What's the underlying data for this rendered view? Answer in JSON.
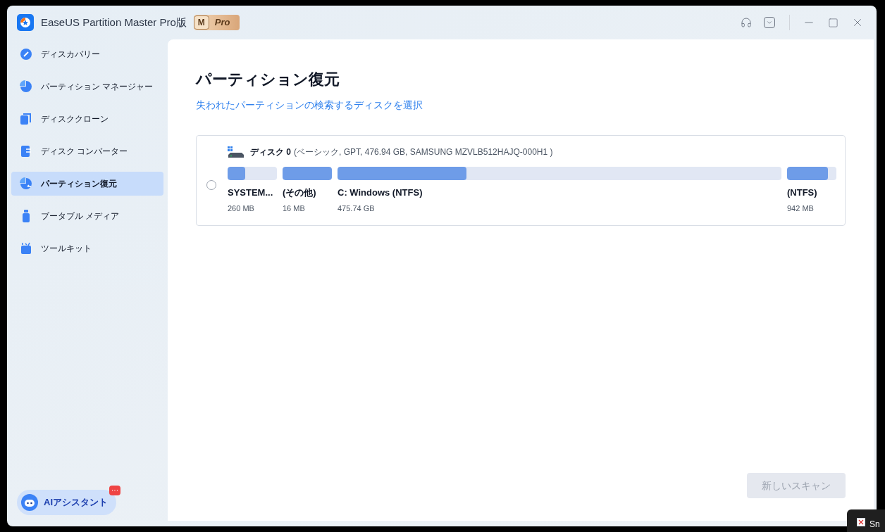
{
  "window": {
    "title": "EaseUS Partition Master Pro版",
    "badge": {
      "letter": "M",
      "label": "Pro"
    }
  },
  "sidebar": {
    "items": [
      {
        "label": "ディスカバリー",
        "selected": false
      },
      {
        "label": "パーティション マネージャー",
        "selected": false
      },
      {
        "label": "ディスククローン",
        "selected": false
      },
      {
        "label": "ディスク コンバーター",
        "selected": false
      },
      {
        "label": "パーティション復元",
        "selected": true
      },
      {
        "label": "ブータブル メディア",
        "selected": false
      },
      {
        "label": "ツールキット",
        "selected": false
      }
    ],
    "assistant": {
      "label": "AIアシスタント",
      "badge": "···"
    }
  },
  "main": {
    "title": "パーティション復元",
    "subtitle": "失われたパーティションの検索するディスクを選択",
    "disks": [
      {
        "name": "ディスク",
        "number": "0",
        "details": "(ベーシック, GPT, 476.94 GB, SAMSUNG MZVLB512HAJQ-000H1 )",
        "selected": false,
        "partitions": [
          {
            "kind": "fixed",
            "label": "SYSTEM...",
            "size": "260 MB",
            "level": 0.36
          },
          {
            "kind": "fixed",
            "label": "(その他)",
            "size": "16 MB",
            "level": 1
          },
          {
            "kind": "grow",
            "label": "C: Windows (NTFS)",
            "size": "475.74 GB",
            "level": 0.29
          },
          {
            "kind": "fixed",
            "label": "(NTFS)",
            "size": "942 MB",
            "level": 0.83
          }
        ]
      }
    ],
    "scan_button": {
      "label": "新しいスキャン",
      "disabled": true
    }
  },
  "overlay_window": {
    "title": "Sn"
  }
}
